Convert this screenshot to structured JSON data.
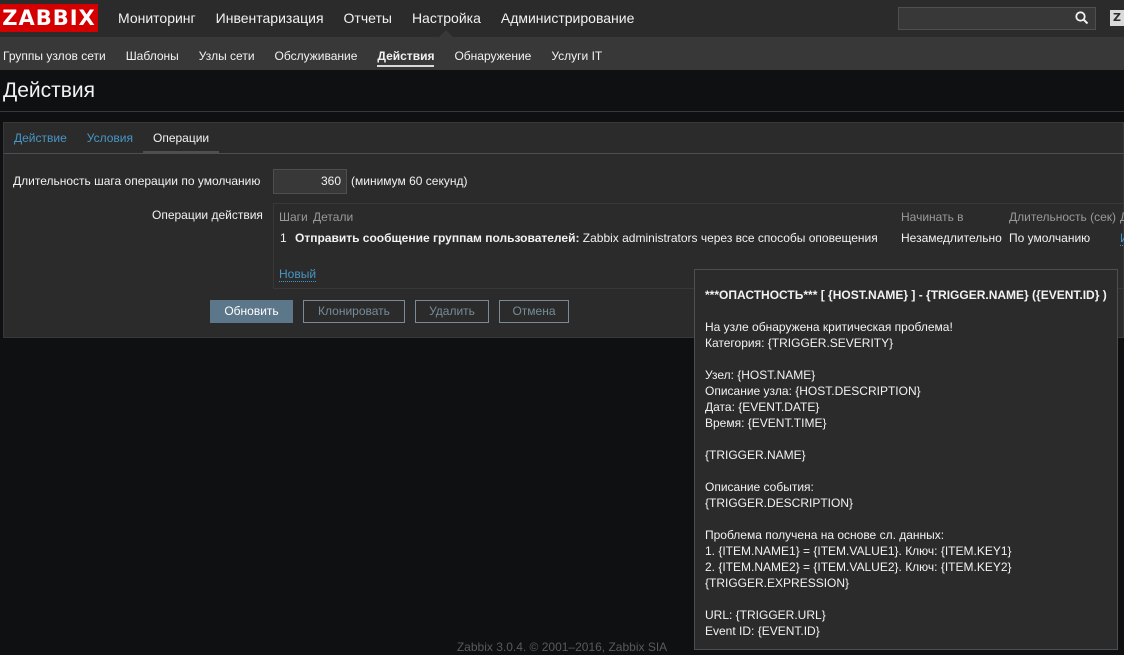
{
  "header": {
    "logo": "ZABBIX",
    "main_menu": [
      "Мониторинг",
      "Инвентаризация",
      "Отчеты",
      "Настройка",
      "Администрирование"
    ],
    "active_main": "Настройка",
    "search": {
      "value": "",
      "placeholder": ""
    },
    "help_glyph": "Z"
  },
  "submenu": [
    "Группы узлов сети",
    "Шаблоны",
    "Узлы сети",
    "Обслуживание",
    "Действия",
    "Обнаружение",
    "Услуги IT"
  ],
  "active_sub": "Действия",
  "page_title": "Действия",
  "tabs": [
    "Действие",
    "Условия",
    "Операции"
  ],
  "active_tab": "Операции",
  "form": {
    "step_duration_label": "Длительность шага операции по умолчанию",
    "step_duration_value": "360",
    "step_duration_hint": "(минимум 60 секунд)",
    "operations_label": "Операции действия",
    "ops_table": {
      "headers": [
        "Шаги",
        "Детали",
        "Начинать в",
        "Длительность (сек)",
        "Д"
      ],
      "row": {
        "step": "1",
        "detail_bold": "Отправить сообщение группам пользователей:",
        "detail_rest": "Zabbix administrators через все способы оповещения",
        "start_in": "Незамедлительно",
        "duration": "По умолчанию",
        "action": "И"
      },
      "new_link": "Новый"
    }
  },
  "buttons": {
    "update": "Обновить",
    "clone": "Клонировать",
    "delete": "Удалить",
    "cancel": "Отмена"
  },
  "tooltip_lines": [
    "***ОПАСТНОСТЬ*** [ {HOST.NAME} ] - {TRIGGER.NAME} ({EVENT.ID} )",
    "",
    "На узле обнаружена критическая проблема!",
    "Категория: {TRIGGER.SEVERITY}",
    "",
    "Узел: {HOST.NAME}",
    "Описание узла: {HOST.DESCRIPTION}",
    "Дата: {EVENT.DATE}",
    "Время: {EVENT.TIME}",
    "",
    "{TRIGGER.NAME}",
    "",
    "Описание события:",
    "{TRIGGER.DESCRIPTION}",
    "",
    "Проблема получена на основе сл. данных:",
    "1. {ITEM.NAME1} = {ITEM.VALUE1}. Ключ: {ITEM.KEY1}",
    "2. {ITEM.NAME2} = {ITEM.VALUE2}. Ключ: {ITEM.KEY2}",
    "{TRIGGER.EXPRESSION}",
    "",
    "URL: {TRIGGER.URL}",
    "Event ID: {EVENT.ID}"
  ],
  "footer": "Zabbix 3.0.4. © 2001–2016, Zabbix SIA",
  "colors": {
    "logo": "#d40000",
    "link": "#4796c4",
    "primary_button": "#5c768a"
  }
}
